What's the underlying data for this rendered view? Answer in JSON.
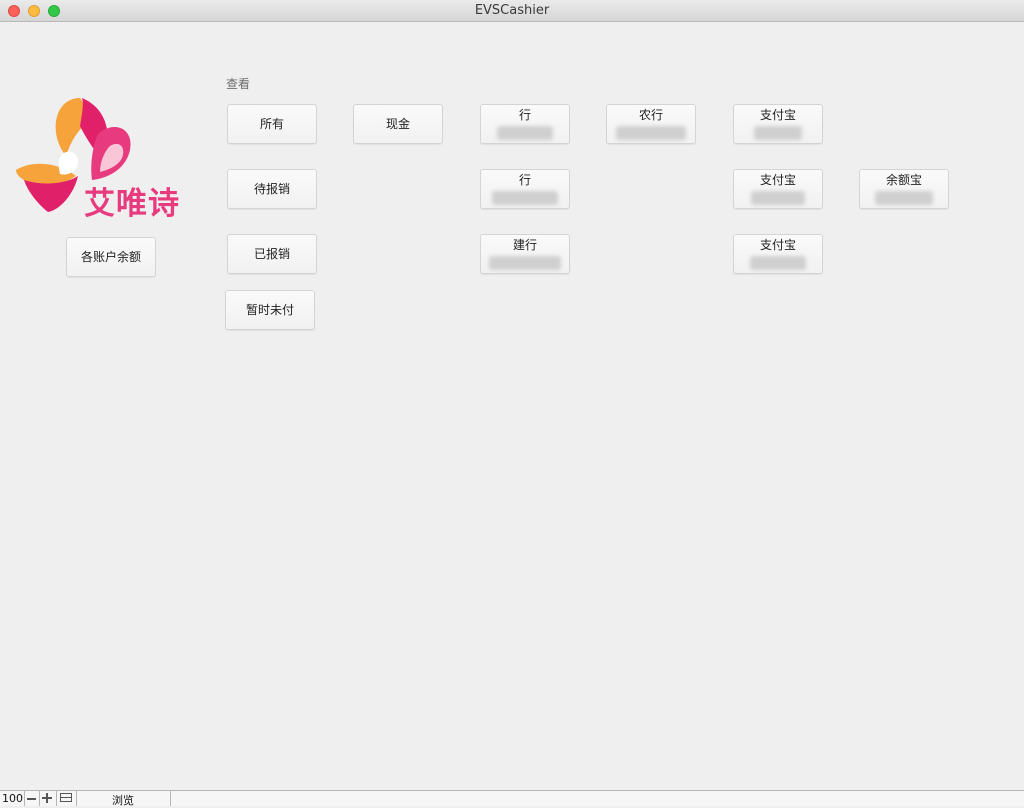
{
  "window": {
    "title": "EVSCashier"
  },
  "logo": {
    "text": "艾唯诗",
    "colors": {
      "pink": "#e83a7e",
      "orange": "#f6a33c",
      "magenta": "#d3145a"
    }
  },
  "view_label": "查看",
  "buttons": {
    "all": "所有",
    "cash": "现金",
    "pending": "待报销",
    "reimbursed": "已报销",
    "unpaid": "暂时未付",
    "balances": "各账户余额",
    "bank1": "行",
    "abc": "农行",
    "alipay1": "支付宝",
    "bank2": "行",
    "alipay2": "支付宝",
    "yuebao": "余额宝",
    "ccb": "建行",
    "alipay3": "支付宝"
  },
  "statusbar": {
    "zoom": "100",
    "mode": "浏览"
  }
}
